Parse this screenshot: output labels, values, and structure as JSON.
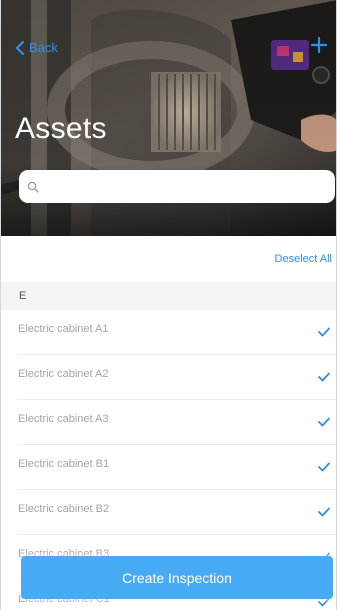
{
  "colors": {
    "accent": "#2f8fe8",
    "button": "#46abf4",
    "item_text": "#a4a4a8",
    "section_bg": "#f4f4f6"
  },
  "nav": {
    "back_label": "Back",
    "back_icon": "chevron-left-icon",
    "add_icon": "plus-icon"
  },
  "header": {
    "title": "Assets",
    "background": "thermal-camera-photo"
  },
  "search": {
    "icon": "search-icon",
    "placeholder": "",
    "value": ""
  },
  "actions": {
    "deselect_all": "Deselect All"
  },
  "section": {
    "letter": "E"
  },
  "assets": [
    {
      "name": "Electric cabinet A1",
      "checked": true
    },
    {
      "name": "Electric cabinet A2",
      "checked": true
    },
    {
      "name": "Electric cabinet A3",
      "checked": true
    },
    {
      "name": "Electric cabinet B1",
      "checked": true
    },
    {
      "name": "Electric cabinet B2",
      "checked": true
    },
    {
      "name": "Electric cabinet B3",
      "checked": true
    },
    {
      "name": "Electric cabinet C1",
      "checked": true
    }
  ],
  "footer": {
    "create_label": "Create Inspection"
  }
}
